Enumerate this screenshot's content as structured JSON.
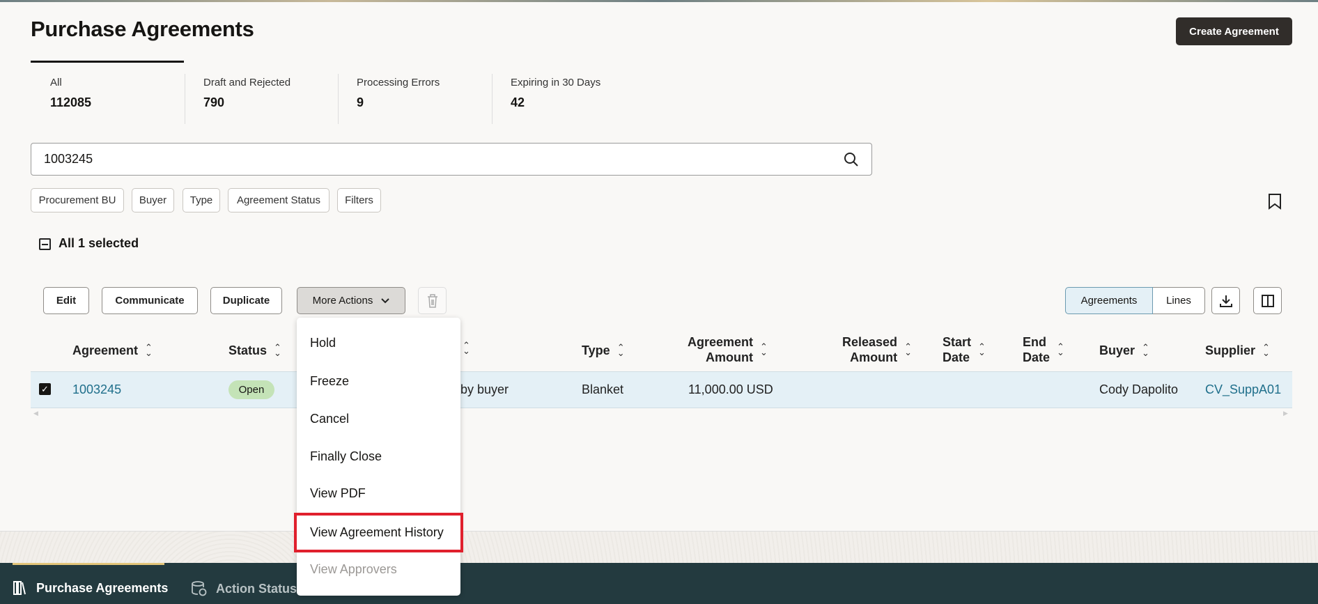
{
  "page": {
    "title": "Purchase Agreements",
    "create_button": "Create Agreement"
  },
  "stats": [
    {
      "label": "All",
      "value": "112085"
    },
    {
      "label": "Draft and Rejected",
      "value": "790"
    },
    {
      "label": "Processing Errors",
      "value": "9"
    },
    {
      "label": "Expiring in 30 Days",
      "value": "42"
    }
  ],
  "search": {
    "value": "1003245"
  },
  "filters": [
    "Procurement BU",
    "Buyer",
    "Type",
    "Agreement Status",
    "Filters"
  ],
  "selection": {
    "label": "All 1 selected"
  },
  "actions": {
    "edit": "Edit",
    "communicate": "Communicate",
    "duplicate": "Duplicate",
    "more": "More Actions"
  },
  "view_toggle": {
    "agreements": "Agreements",
    "lines": "Lines"
  },
  "table": {
    "headers": {
      "agreement": "Agreement",
      "status": "Status",
      "type": "Type",
      "agreement_amount_1": "Agreement",
      "agreement_amount_2": "Amount",
      "released_amount_1": "Released",
      "released_amount_2": "Amount",
      "start_date_1": "Start",
      "start_date_2": "Date",
      "end_date_1": "End",
      "end_date_2": "Date",
      "buyer": "Buyer",
      "supplier": "Supplier"
    },
    "row": {
      "agreement": "1003245",
      "status": "Open",
      "hidden_col": "r by buyer",
      "type": "Blanket",
      "agreement_amount": "11,000.00 USD",
      "buyer": "Cody Dapolito",
      "supplier": "CV_SuppA01"
    }
  },
  "menu": {
    "items": [
      {
        "label": "Hold"
      },
      {
        "label": "Freeze"
      },
      {
        "label": "Cancel"
      },
      {
        "label": "Finally Close"
      },
      {
        "label": "View PDF"
      },
      {
        "label": "View Agreement History"
      },
      {
        "label": "View Approvers"
      }
    ]
  },
  "footer": {
    "tabs": [
      "Purchase Agreements",
      "Action Status"
    ]
  },
  "colors": {
    "accent_link": "#1f6f8b",
    "footer_bg": "#233a3f",
    "highlight": "#e0202d",
    "selected_row": "#e4f0f6"
  }
}
